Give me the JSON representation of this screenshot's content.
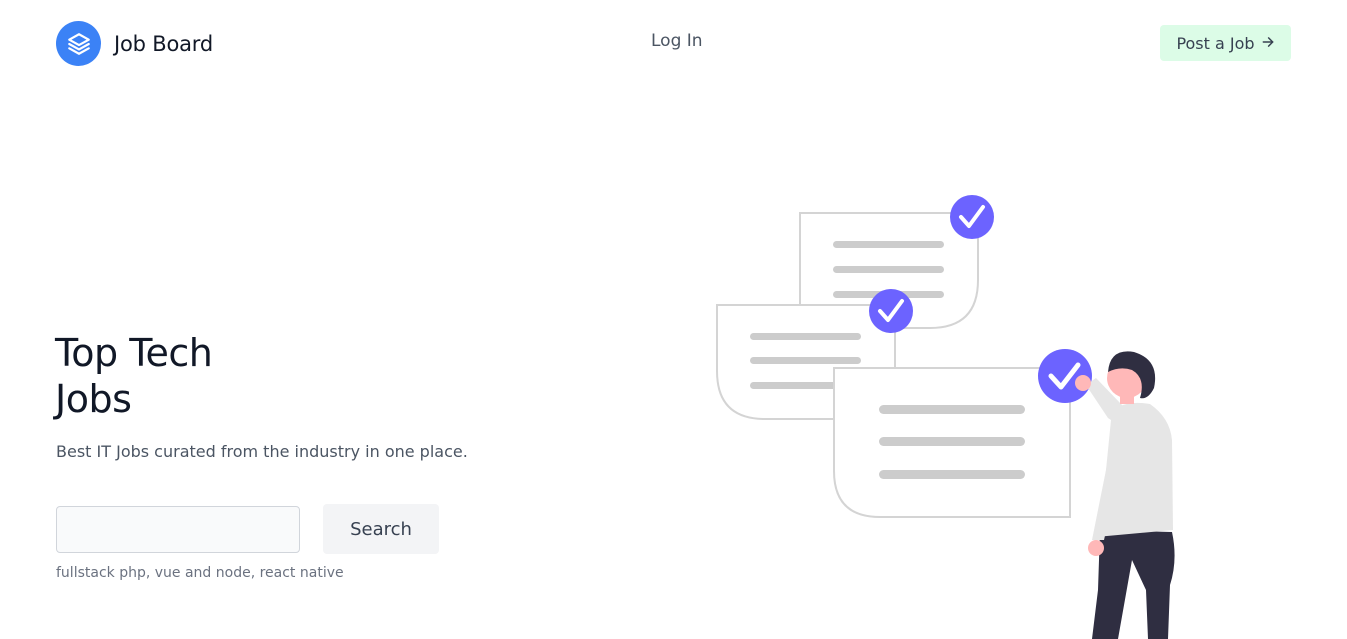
{
  "header": {
    "brand_name": "Job Board",
    "brand_icon": "layers-icon",
    "login_label": "Log In",
    "post_job_label": "Post a Job",
    "post_job_icon": "arrow-right-icon"
  },
  "hero": {
    "title_line1": "Top Tech",
    "title_line2": "Jobs",
    "subtitle": "Best IT Jobs curated from the industry in one place.",
    "search_value": "",
    "search_placeholder": "",
    "search_button": "Search",
    "hint": "fullstack php, vue and node, react native"
  },
  "colors": {
    "brand": "#3b82f6",
    "post_job_bg": "#dcfce7",
    "check_purple": "#6c63ff",
    "person_dark": "#2f2e41",
    "skin": "#ffb8b8"
  }
}
